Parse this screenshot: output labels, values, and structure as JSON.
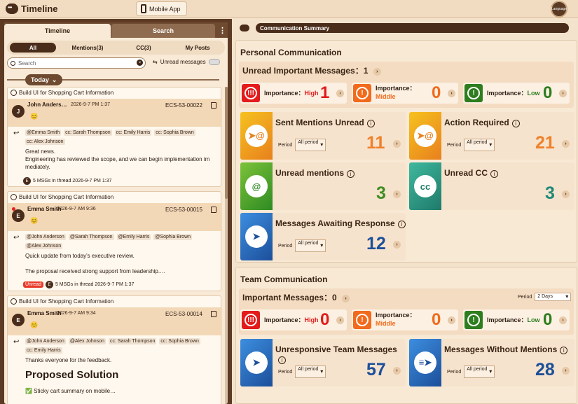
{
  "app": {
    "title": "Timeline",
    "mobile_label": "Mobile App",
    "lang_label": "Language"
  },
  "left": {
    "tabs": [
      "Timeline",
      "Search"
    ],
    "filters": [
      "All",
      "Mentions(3)",
      "CC(3)",
      "My Posts"
    ],
    "search_placeholder": "Search",
    "unread_label": "Unread messages",
    "today": "Today"
  },
  "cards": [
    {
      "project": "Build UI for Shopping Cart Information",
      "avatar": "J",
      "sender": "John Anders…",
      "time": "2026-9-7 PM 1:37",
      "ecs": "ECS-53-00022",
      "cc": [
        "@Emma Smith",
        "cc: Sarah Thompson",
        "cc: Emily Harris",
        "cc: Sophia Brown",
        "cc: Alex Johnson"
      ],
      "body": [
        "Great news.",
        "Engineering has reviewed the scope, and we can begin implementation im",
        "mediately."
      ],
      "thread_avatar": "E",
      "thread": "5 MSGs in thread 2026-9-7 PM 1:37"
    },
    {
      "project": "Build UI for Shopping Cart Information",
      "avatar": "E",
      "sender": "Emma Smith",
      "time": "2026-9-7 AM 9:36",
      "ecs": "ECS-53-00015",
      "cc": [
        "@John Anderson",
        "@Sarah Thompson",
        "@Emily Harris",
        "@Sophia Brown",
        "@Alex Johnson"
      ],
      "body": [
        "Quick update from today's executive review.",
        "",
        "The proposal received strong support from leadership.…"
      ],
      "unread": "Unread",
      "thread_avatar": "E",
      "thread": "5 MSGs in thread 2026-9-7 PM 1:37"
    },
    {
      "project": "Build UI for Shopping Cart Information",
      "avatar": "E",
      "sender": "Emma Smith",
      "time": "2026-9-7 AM 9:34",
      "ecs": "ECS-53-00014",
      "cc": [
        "@John Anderson",
        "@Alex Johnson",
        "cc: Sarah Thompson",
        "cc: Sophia Brown",
        "cc: Emily Harris"
      ],
      "body": [
        "Thanks everyone for the feedback."
      ],
      "heading": "Proposed Solution",
      "bullet": "✅ Sticky cart summary on mobile…"
    }
  ],
  "right": {
    "bar_title": "Communication Summary",
    "personal": {
      "title": "Personal Communication",
      "important_title": "Unread Important Messages：1",
      "high_label": "Importance：",
      "high_word": "High",
      "high_num": "1",
      "mid_label": "Importance：",
      "mid_word": "Middle",
      "mid_num": "0",
      "low_label": "Importance：",
      "low_word": "Low",
      "low_num": "0",
      "sent_mentions": {
        "title": "Sent Mentions Unread",
        "num": "11"
      },
      "action_required": {
        "title": "Action Required",
        "num": "21"
      },
      "unread_mentions": {
        "title": "Unread mentions",
        "num": "3"
      },
      "unread_cc": {
        "title": "Unread CC",
        "num": "3"
      },
      "awaiting": {
        "title": "Messages Awaiting Response",
        "num": "12"
      },
      "period_label": "Period",
      "period_value": "All period"
    },
    "team": {
      "title": "Team Communication",
      "important_title": "Important Messages：0",
      "period_label": "Period",
      "period_value": "2 Days",
      "high_label": "Importance：",
      "high_word": "High",
      "high_num": "0",
      "mid_label": "Importance：",
      "mid_word": "Middle",
      "mid_num": "0",
      "low_label": "Importance：",
      "low_word": "Low",
      "low_num": "0",
      "unresponsive": {
        "title": "Unresponsive Team Messages",
        "num": "57"
      },
      "without_mentions": {
        "title": "Messages Without Mentions",
        "num": "28"
      }
    }
  },
  "colors": {
    "high": "#e31b1b",
    "middle": "#f26a1b",
    "low": "#2e7d1f",
    "orange_num": "#f0802a",
    "green_num": "#3e8e23",
    "teal_num": "#1f8a7a",
    "blue_num": "#1c4f9a"
  }
}
